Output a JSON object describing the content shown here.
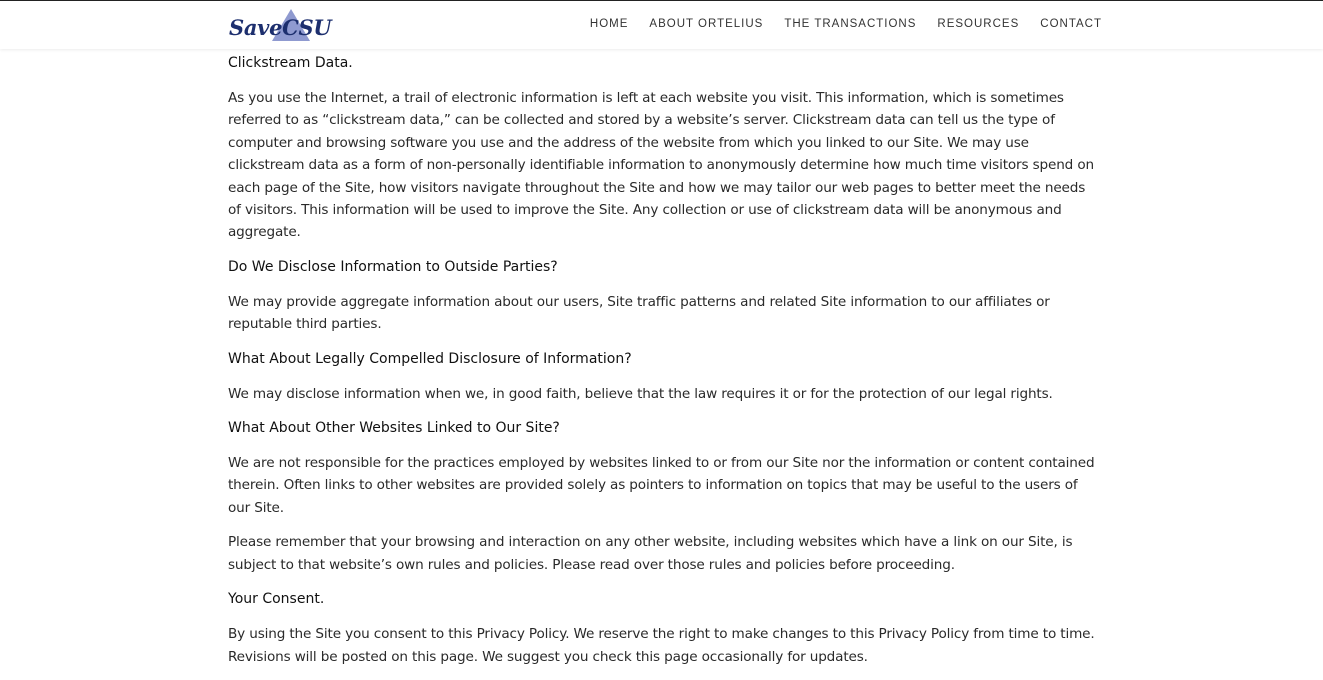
{
  "header": {
    "logo_text": "SaveCSU",
    "nav": [
      {
        "label": "HOME"
      },
      {
        "label": "ABOUT ORTELIUS"
      },
      {
        "label": "THE TRANSACTIONS"
      },
      {
        "label": "RESOURCES"
      },
      {
        "label": "CONTACT"
      }
    ]
  },
  "sections": [
    {
      "heading": "Clickstream Data.",
      "paragraphs": [
        "As you use the Internet, a trail of electronic information is left at each website you visit. This information, which is sometimes referred to as “clickstream data,” can be collected and stored by a website’s server.  Clickstream data can tell us the type of computer and browsing software you use and the address of the website from which you linked to our Site.  We may use clickstream data as a form of non-personally identifiable information to anonymously determine how much time visitors spend on each page of the Site, how visitors navigate throughout the Site and how we may tailor our web pages to better meet the needs of visitors.  This information will be used to improve the Site.  Any collection or use of clickstream data will be anonymous and aggregate."
      ]
    },
    {
      "heading": "Do We Disclose Information to Outside Parties?",
      "paragraphs": [
        "We may provide aggregate information about our users, Site traffic patterns and related Site information to our affiliates or reputable third parties."
      ]
    },
    {
      "heading": "What About Legally Compelled Disclosure of Information?",
      "paragraphs": [
        "We may disclose information when we, in good faith, believe that the law requires it or for the protection of our legal rights."
      ]
    },
    {
      "heading": "What About Other Websites Linked to Our Site?",
      "paragraphs": [
        "We are not responsible for the practices employed by websites linked to or from our Site nor the information or content contained therein. Often links to other websites are provided solely as pointers to information on topics that may be useful to the users of our Site.",
        "Please remember that your browsing and interaction on any other website, including websites which have a link on our Site, is subject to that website’s own rules and policies.  Please read over those rules and policies before proceeding."
      ]
    },
    {
      "heading": "Your Consent.",
      "paragraphs": [
        "By using the Site you consent to this Privacy Policy.  We reserve the right to make changes to this Privacy Policy from time to time.  Revisions will be posted on this page.  We suggest you check this page occasionally for updates."
      ]
    }
  ]
}
